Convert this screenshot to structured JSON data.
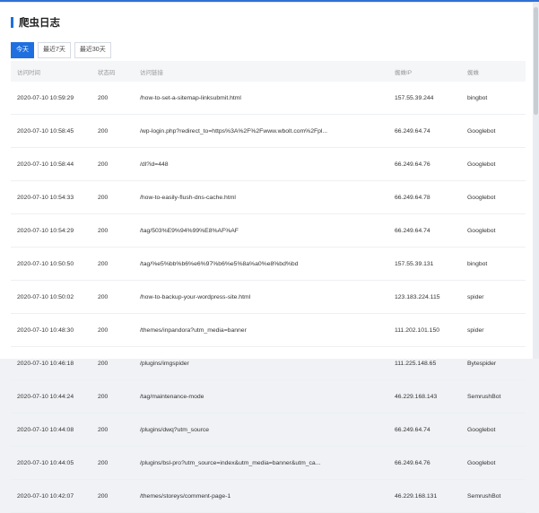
{
  "page": {
    "title": "爬虫日志",
    "tabs": [
      {
        "label": "今天",
        "active": true
      },
      {
        "label": "最近7天",
        "active": false
      },
      {
        "label": "最近30天",
        "active": false
      }
    ]
  },
  "table": {
    "headers": [
      "访问时间",
      "状态码",
      "访问链接",
      "蜘蛛IP",
      "蜘蛛"
    ],
    "rows": [
      [
        "2020-07-10 10:59:29",
        "200",
        "/how-to-set-a-sitemap-linksubmit.html",
        "157.55.39.244",
        "bingbot"
      ],
      [
        "2020-07-10 10:58:45",
        "200",
        "/wp-login.php?redirect_to=https%3A%2F%2Fwww.wbolt.com%2Fpl...",
        "66.249.64.74",
        "Googlebot"
      ],
      [
        "2020-07-10 10:58:44",
        "200",
        "/dl?id=448",
        "66.249.64.76",
        "Googlebot"
      ],
      [
        "2020-07-10 10:54:33",
        "200",
        "/how-to-easily-flush-dns-cache.html",
        "66.249.64.78",
        "Googlebot"
      ],
      [
        "2020-07-10 10:54:29",
        "200",
        "/tag/503%E9%94%99%E8%AF%AF",
        "66.249.64.74",
        "Googlebot"
      ],
      [
        "2020-07-10 10:50:50",
        "200",
        "/tag/%e5%bb%b6%e6%97%b6%e5%8a%a0%e8%bd%bd",
        "157.55.39.131",
        "bingbot"
      ],
      [
        "2020-07-10 10:50:02",
        "200",
        "/how-to-backup-your-wordpress-site.html",
        "123.183.224.115",
        "spider"
      ],
      [
        "2020-07-10 10:48:30",
        "200",
        "/themes/inpandora?utm_media=banner",
        "111.202.101.150",
        "spider"
      ],
      [
        "2020-07-10 10:46:18",
        "200",
        "/plugins/imgspider",
        "111.225.148.65",
        "Bytespider"
      ],
      [
        "2020-07-10 10:44:24",
        "200",
        "/tag/maintenance-mode",
        "46.229.168.143",
        "SemrushBot"
      ],
      [
        "2020-07-10 10:44:08",
        "200",
        "/plugins/dwq?utm_source",
        "66.249.64.74",
        "Googlebot"
      ],
      [
        "2020-07-10 10:44:05",
        "200",
        "/plugins/bsl-pro?utm_source=index&utm_media=banner&utm_ca...",
        "66.249.64.76",
        "Googlebot"
      ],
      [
        "2020-07-10 10:42:07",
        "200",
        "/themes/storeys/comment-page-1",
        "46.229.168.131",
        "SemrushBot"
      ]
    ]
  }
}
